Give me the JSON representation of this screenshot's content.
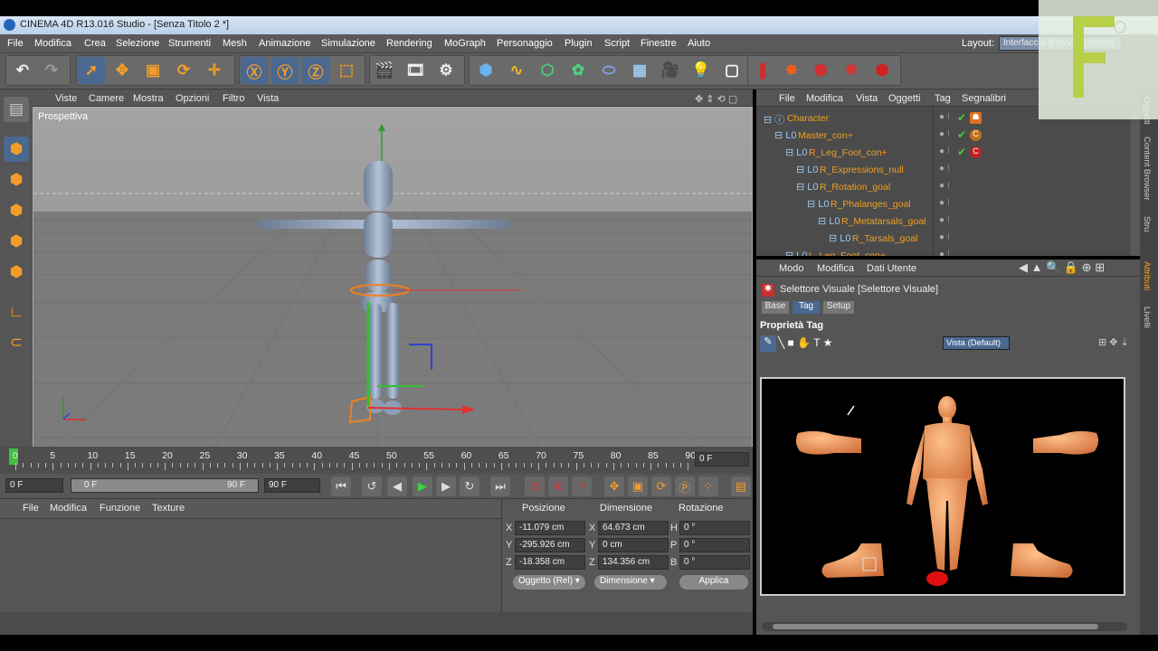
{
  "window": {
    "title": "CINEMA 4D R13.016 Studio - [Senza Titolo 2 *]"
  },
  "menubar": {
    "items": [
      "File",
      "Modifica",
      "Crea",
      "Selezione",
      "Strumenti",
      "Mesh",
      "Animazione",
      "Simulazione",
      "Rendering",
      "MoGraph",
      "Personaggio",
      "Plugin",
      "Script",
      "Finestre",
      "Aiuto"
    ],
    "layout_label": "Layout:",
    "layout_value": "Interfaccia di Avvio (Utente)"
  },
  "toolbar": {
    "icons": [
      "undo-icon",
      "redo-icon",
      "select-icon",
      "move-icon",
      "scale-icon",
      "rotate-icon",
      "live-select-icon",
      "x-axis-icon",
      "y-axis-icon",
      "z-axis-icon",
      "coordinate-system-icon",
      "render-view-icon",
      "render-picture-viewer-icon",
      "render-settings-icon",
      "cube-icon",
      "spline-icon",
      "nurbs-icon",
      "array-icon",
      "deformer-icon",
      "floor-icon",
      "camera-icon",
      "light-icon",
      "scene-icon",
      "bodypaint-icon",
      "explosion-icon",
      "mograph-cloner-icon",
      "particles-icon",
      "hair-icon"
    ]
  },
  "viewport": {
    "menu": [
      "Viste",
      "Camere",
      "Mostra",
      "Opzioni",
      "Filtro",
      "Vista"
    ],
    "label": "Prospettiva"
  },
  "timeline": {
    "ticks": [
      "0",
      "5",
      "10",
      "15",
      "20",
      "25",
      "30",
      "35",
      "40",
      "45",
      "50",
      "55",
      "60",
      "65",
      "70",
      "75",
      "80",
      "85",
      "90"
    ],
    "current": "0 F"
  },
  "transport": {
    "start": "0 F",
    "slider_left": "0 F",
    "slider_right": "90 F",
    "end": "90 F"
  },
  "materials": {
    "menu": [
      "File",
      "Modifica",
      "Funzione",
      "Texture"
    ]
  },
  "coordinates": {
    "headers": [
      "Posizione",
      "Dimensione",
      "Rotazione"
    ],
    "rows": [
      {
        "axis": "X",
        "pos": "-11.079 cm",
        "dimaxis": "X",
        "dim": "64.673 cm",
        "rotaxis": "H",
        "rot": "0 °"
      },
      {
        "axis": "Y",
        "pos": "-295.926 cm",
        "dimaxis": "Y",
        "dim": "0 cm",
        "rotaxis": "P",
        "rot": "0 °"
      },
      {
        "axis": "Z",
        "pos": "-18.358 cm",
        "dimaxis": "Z",
        "dim": "134.356 cm",
        "rotaxis": "B",
        "rot": "0 °"
      }
    ],
    "mode1": "Oggetto (Rel)",
    "mode2": "Dimensione",
    "apply": "Applica"
  },
  "objects": {
    "menu": [
      "File",
      "Modifica",
      "Vista",
      "Oggetti",
      "Tag",
      "Segnalibri"
    ],
    "items": [
      "Character",
      "Master_con+",
      "R_Leg_Foot_con+",
      "R_Expressions_null",
      "R_Rotation_goal",
      "R_Phalanges_goal",
      "R_Metatarsals_goal",
      "R_Tarsals_goal",
      "L_Leg_Foot_con+"
    ]
  },
  "attributes": {
    "menu": [
      "Modo",
      "Modifica",
      "Dati Utente"
    ],
    "title": "Selettore Visuale [Selettore Visuale]",
    "tabs": [
      "Base",
      "Tag",
      "Setup"
    ],
    "section": "Proprietà Tag",
    "view_btn": "Vista (Default)"
  },
  "sidetabs": [
    "Oggetti",
    "Content Browser",
    "Stru",
    "Attributi",
    "Livelli"
  ],
  "colors": {
    "accent": "#f0a020",
    "menubar": "#5a5a5a",
    "panel": "#555555"
  }
}
